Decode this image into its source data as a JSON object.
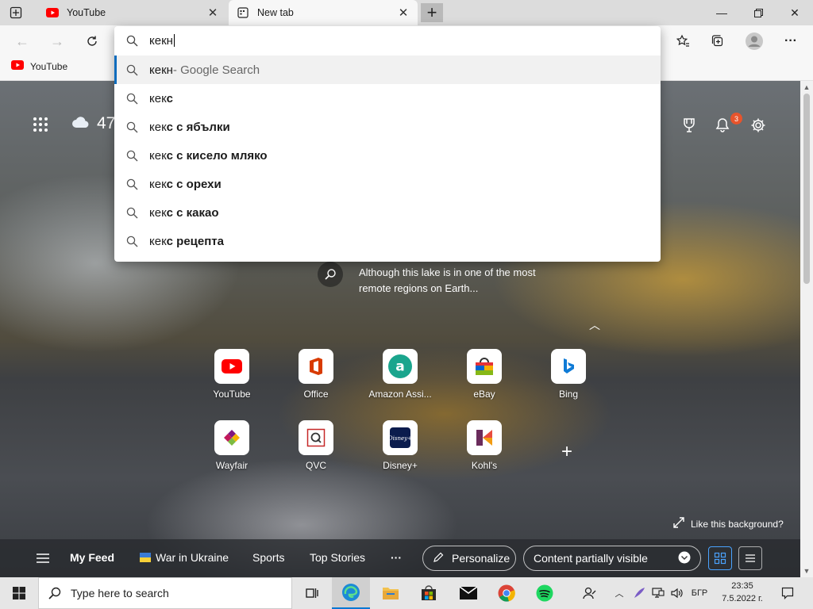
{
  "tabs": [
    {
      "label": "YouTube",
      "icon": "youtube-favicon"
    },
    {
      "label": "New tab",
      "icon": "newtab-icon"
    }
  ],
  "favorites": [
    {
      "label": "YouTube",
      "icon": "youtube-favicon"
    }
  ],
  "omnibox": {
    "query": "кекн",
    "suggestions": [
      {
        "prefix": "кекн",
        "suffix": " - Google Search",
        "muted": true
      },
      {
        "prefix": "кек",
        "suffix": "с",
        "muted": false
      },
      {
        "prefix": "кек",
        "suffix": "с с ябълки",
        "muted": false
      },
      {
        "prefix": "кек",
        "suffix": "с с кисело мляко",
        "muted": false
      },
      {
        "prefix": "кек",
        "suffix": "с с орехи",
        "muted": false
      },
      {
        "prefix": "кек",
        "suffix": "с с какао",
        "muted": false
      },
      {
        "prefix": "кек",
        "suffix": "с рецепта",
        "muted": false
      }
    ]
  },
  "newtab": {
    "weather_temp": "47",
    "notification_count": "3",
    "caption_line1": "Although this lake is in one of the most",
    "caption_line2": "remote regions on Earth...",
    "like_background": "Like this background?",
    "tiles": [
      {
        "label": "YouTube"
      },
      {
        "label": "Office"
      },
      {
        "label": "Amazon Assi..."
      },
      {
        "label": "eBay"
      },
      {
        "label": "Bing"
      },
      {
        "label": "Wayfair"
      },
      {
        "label": "QVC"
      },
      {
        "label": "Disney+"
      },
      {
        "label": "Kohl's"
      }
    ]
  },
  "feed": {
    "my_feed": "My Feed",
    "war_in_ukraine": "War in Ukraine",
    "sports": "Sports",
    "top_stories": "Top Stories",
    "more": "···",
    "personalize": "Personalize",
    "content_visibility": "Content partially visible"
  },
  "taskbar": {
    "search_placeholder": "Type here to search",
    "language": "БГР",
    "time": "23:35",
    "date": "7.5.2022 г."
  },
  "colors": {
    "accent": "#0f6cbd",
    "youtube_red": "#ff0000",
    "badge": "#e8542c"
  }
}
